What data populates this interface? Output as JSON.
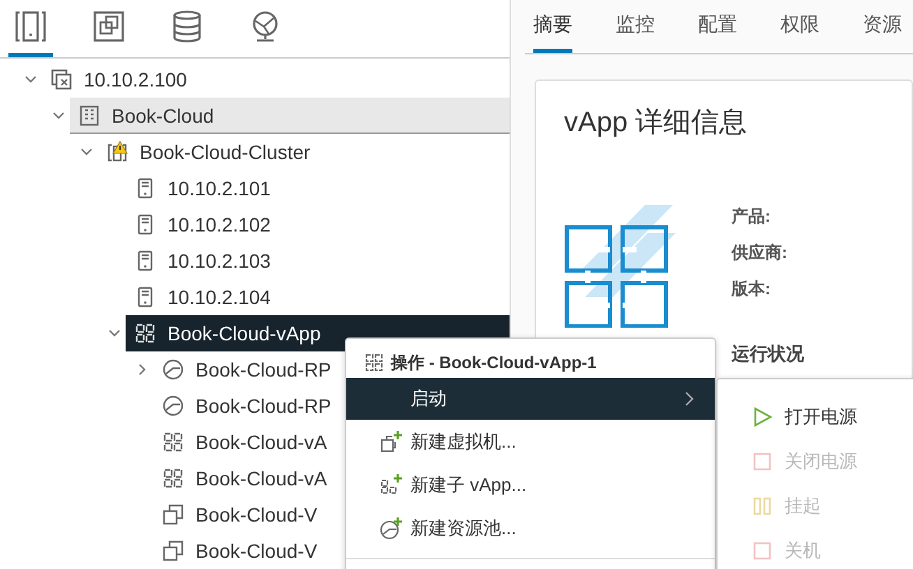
{
  "nav_tabs": [
    {
      "kind": "hosts",
      "selected": true
    },
    {
      "kind": "vms",
      "selected": false
    },
    {
      "kind": "storage",
      "selected": false
    },
    {
      "kind": "network",
      "selected": false
    }
  ],
  "tree": [
    {
      "kind": "vcenter",
      "label": "10.10.2.100",
      "expanded": true,
      "selected": false,
      "hovered": false,
      "children": [
        {
          "kind": "datacenter",
          "label": "Book-Cloud",
          "expanded": true,
          "selected": false,
          "hovered": true,
          "children": [
            {
              "kind": "cluster",
              "alert": true,
              "label": "Book-Cloud-Cluster",
              "expanded": true,
              "selected": false,
              "hovered": false,
              "children": [
                {
                  "kind": "host",
                  "label": "10.10.2.101",
                  "selected": false,
                  "hovered": false
                },
                {
                  "kind": "host",
                  "label": "10.10.2.102",
                  "selected": false,
                  "hovered": false
                },
                {
                  "kind": "host",
                  "label": "10.10.2.103",
                  "selected": false,
                  "hovered": false
                },
                {
                  "kind": "host",
                  "label": "10.10.2.104",
                  "selected": false,
                  "hovered": false
                },
                {
                  "kind": "vapp",
                  "label": "Book-Cloud-vApp",
                  "expanded": true,
                  "selected": true,
                  "hovered": false,
                  "children": [
                    {
                      "kind": "pool",
                      "label": "Book-Cloud-RP",
                      "expanded": false,
                      "selected": false,
                      "hovered": false
                    },
                    {
                      "kind": "pool",
                      "label": "Book-Cloud-RP",
                      "selected": false,
                      "hovered": false
                    },
                    {
                      "kind": "vapp",
                      "label": "Book-Cloud-vA",
                      "selected": false,
                      "hovered": false
                    },
                    {
                      "kind": "vapp",
                      "label": "Book-Cloud-vA",
                      "selected": false,
                      "hovered": false
                    },
                    {
                      "kind": "vm",
                      "label": "Book-Cloud-V",
                      "selected": false,
                      "hovered": false
                    },
                    {
                      "kind": "vm",
                      "label": "Book-Cloud-V",
                      "selected": false,
                      "hovered": false
                    }
                  ]
                }
              ]
            }
          ]
        }
      ]
    }
  ],
  "tabs": [
    {
      "label": "摘要",
      "selected": true
    },
    {
      "label": "监控",
      "selected": false
    },
    {
      "label": "配置",
      "selected": false
    },
    {
      "label": "权限",
      "selected": false
    },
    {
      "label": "资源",
      "selected": false
    }
  ],
  "details": {
    "title": "vApp 详细信息",
    "fields": [
      "产品:",
      "供应商:",
      "版本:"
    ],
    "section": "运行状况"
  },
  "context_menu": {
    "title": "操作 - Book-Cloud-vApp-1",
    "items": [
      {
        "kind": "submenu",
        "label": "启动",
        "highlighted": true
      },
      {
        "kind": "new-vm",
        "label": "新建虚拟机...",
        "highlighted": false
      },
      {
        "kind": "new-vapp",
        "label": "新建子 vApp...",
        "highlighted": false
      },
      {
        "kind": "new-pool",
        "label": "新建资源池...",
        "highlighted": false
      }
    ]
  },
  "submenu": [
    {
      "kind": "power-on",
      "label": "打开电源",
      "disabled": false
    },
    {
      "kind": "power-off",
      "label": "关闭电源",
      "disabled": true
    },
    {
      "kind": "suspend",
      "label": "挂起",
      "disabled": true
    },
    {
      "kind": "shutdown",
      "label": "关机",
      "disabled": true
    }
  ]
}
